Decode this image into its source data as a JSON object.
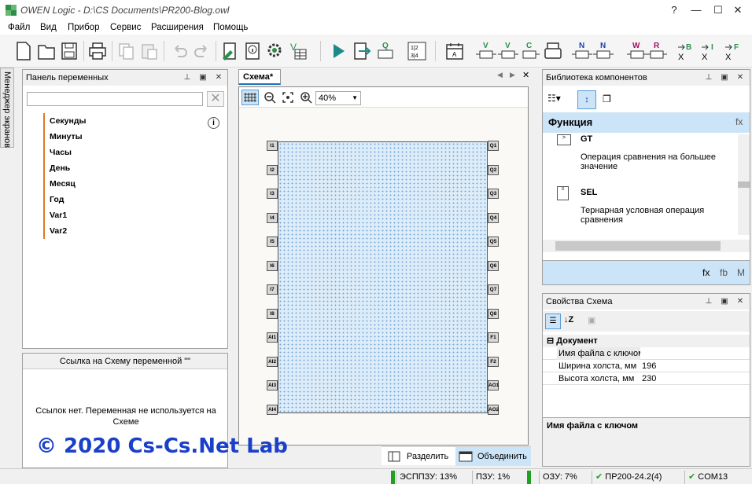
{
  "window": {
    "title": "OWEN Logic - D:\\CS Documents\\PR200-Blog.owl",
    "help_label": "?",
    "minimize_label": "—",
    "maximize_label": "☐",
    "close_label": "✕"
  },
  "menu": [
    "Файл",
    "Вид",
    "Прибор",
    "Сервис",
    "Расширения",
    "Помощь"
  ],
  "toolbar": {
    "q_label": "Q",
    "v_label": "V",
    "c_label": "C",
    "n_label": "N",
    "w_label": "W",
    "r_label": "R",
    "b_label": "B",
    "i_label": "I",
    "f_label": "F",
    "x_label": "X",
    "frac_top": "1|2",
    "frac_bot": "3|4"
  },
  "left_tab": "Менеджер экранов",
  "variables_panel": {
    "title": "Панель переменных",
    "search_placeholder": "",
    "variables": [
      "Секунды",
      "Минуты",
      "Часы",
      "День",
      "Месяц",
      "Год",
      "Var1",
      "Var2"
    ]
  },
  "reference_panel": {
    "title": "Ссылка на Схему переменной \"\"",
    "message": "Ссылок нет. Переменная не используется на Схеме"
  },
  "schema": {
    "tab": "Схема*",
    "zoom": "40%",
    "inputs": [
      "I1",
      "I2",
      "I3",
      "I4",
      "I5",
      "I6",
      "I7",
      "I8",
      "AI1",
      "AI2",
      "AI3",
      "AI4"
    ],
    "outputs": [
      "Q1",
      "Q2",
      "Q3",
      "Q4",
      "Q5",
      "Q6",
      "Q7",
      "Q8",
      "F1",
      "F2",
      "AO1",
      "AO2"
    ],
    "split_label": "Разделить",
    "merge_label": "Объединить"
  },
  "library": {
    "title": "Библиотека компонентов",
    "category": "Функция",
    "fx_label": "fx",
    "items": [
      {
        "name": "GT",
        "desc": "Операция сравнения на большее значение"
      },
      {
        "name": "SEL",
        "desc": "Тернарная условная операция сравнения"
      }
    ],
    "tabs": [
      "fx",
      "fb",
      "M"
    ]
  },
  "properties": {
    "title": "Свойства Схема",
    "group": "Документ",
    "rows": [
      {
        "name": "Имя файла с ключом",
        "value": ""
      },
      {
        "name": "Ширина холста, мм",
        "value": "196"
      },
      {
        "name": "Высота холста, мм",
        "value": "230"
      }
    ],
    "description": "Имя файла с ключом"
  },
  "status": {
    "eeprom": "ЭСППЗУ: 13%",
    "rom": "ПЗУ: 1%",
    "ram": "ОЗУ: 7%",
    "device": "ПР200-24.2(4)",
    "port": "COM13"
  },
  "watermark": "© 2020 Cs-Cs.Net Lab",
  "colors": {
    "accent": "#1e73be",
    "selection": "#cce4f7",
    "block_fill": "#dcecf8",
    "orange": "#e07820",
    "green": "#20a020",
    "watermark": "#1a3fc8"
  }
}
